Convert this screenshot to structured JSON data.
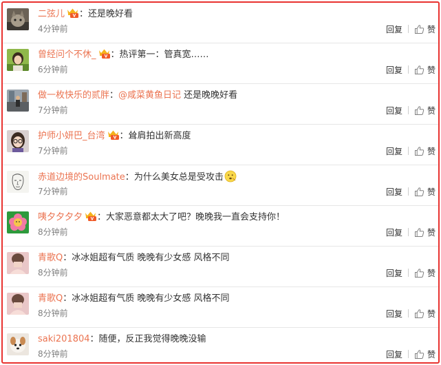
{
  "colors": {
    "frame": "#e8312e",
    "username": "#eb7350",
    "text": "#333333",
    "time": "#808080"
  },
  "labels": {
    "reply": "回复",
    "like": "赞"
  },
  "comments": [
    {
      "user": "二弦儿",
      "vip": true,
      "colon": "：",
      "text": "还是晚好看",
      "time": "4分钟前",
      "avatar": "cat-photo-avatar"
    },
    {
      "user": "曾经问个不休_",
      "vip": true,
      "colon": "：",
      "text": "热评第一：管真宽……",
      "time": "6分钟前",
      "avatar": "girl-green-photo-avatar"
    },
    {
      "user": "做一枚快乐的贰胖",
      "vip": false,
      "colon": "：",
      "mention": "@咸菜黄鱼日记",
      "text": " 还是晚晚好看",
      "time": "7分钟前",
      "avatar": "street-photo-avatar"
    },
    {
      "user": "护师小妍巴_台湾",
      "vip": true,
      "colon": "：",
      "text": "耸肩拍出新高度",
      "time": "7分钟前",
      "avatar": "girl-glasses-photo-avatar"
    },
    {
      "user": "赤道边境的Soulmate",
      "vip": false,
      "colon": "：",
      "text": "为什么美女总是受攻击",
      "emoji": "thinking-emoji-icon",
      "time": "7分钟前",
      "avatar": "sketch-face-avatar"
    },
    {
      "user": "咦夕夕夕夕",
      "vip": true,
      "colon": "：",
      "text": "大家恶意都太大了吧？晚晚我一直会支持你！",
      "time": "8分钟前",
      "avatar": "flower-cartoon-avatar"
    },
    {
      "user": "青歌Q",
      "vip": false,
      "colon": "：",
      "text": "冰冰姐超有气质 晚晚有少女感 风格不同",
      "time": "8分钟前",
      "avatar": "pink-photo-avatar"
    },
    {
      "user": "青歌Q",
      "vip": false,
      "colon": "：",
      "text": "冰冰姐超有气质 晚晚有少女感 风格不同",
      "time": "8分钟前",
      "avatar": "pink-photo-avatar"
    },
    {
      "user": "saki201804",
      "vip": false,
      "colon": "：",
      "text": "随便，反正我觉得晚晚没输",
      "time": "8分钟前",
      "avatar": "dog-photo-avatar"
    }
  ]
}
